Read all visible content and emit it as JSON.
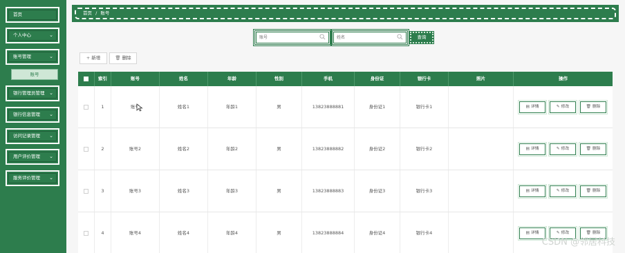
{
  "sidebar": {
    "items": [
      {
        "label": "首页",
        "has_chevron": false
      },
      {
        "label": "个人中心",
        "has_chevron": true
      },
      {
        "label": "账号管理",
        "has_chevron": true
      },
      {
        "label": "银行管理员管理",
        "has_chevron": true
      },
      {
        "label": "银行信息管理",
        "has_chevron": true
      },
      {
        "label": "访问记录管理",
        "has_chevron": true
      },
      {
        "label": "用户评价管理",
        "has_chevron": true
      },
      {
        "label": "服务评价管理",
        "has_chevron": true
      }
    ],
    "submenu": {
      "label": "账号"
    },
    "chevron_glyph": "⌄"
  },
  "breadcrumb": {
    "home": "首页",
    "separator": "/",
    "current": "账号"
  },
  "search": {
    "field1_placeholder": "账号",
    "field2_placeholder": "姓名",
    "button_label": "查询"
  },
  "toolbar": {
    "add_label": "新增",
    "delete_label": "删除"
  },
  "table": {
    "headers": [
      "",
      "索引",
      "账号",
      "姓名",
      "年龄",
      "性别",
      "手机",
      "身份证",
      "银行卡",
      "照片",
      "操作"
    ],
    "rows": [
      {
        "index": "1",
        "account": "账号",
        "name": "姓名1",
        "age": "年龄1",
        "gender": "男",
        "phone": "13823888881",
        "idcard": "身份证1",
        "bankcard": "银行卡1",
        "photo": ""
      },
      {
        "index": "2",
        "account": "账号2",
        "name": "姓名2",
        "age": "年龄2",
        "gender": "男",
        "phone": "13823888882",
        "idcard": "身份证2",
        "bankcard": "银行卡2",
        "photo": ""
      },
      {
        "index": "3",
        "account": "账号3",
        "name": "姓名3",
        "age": "年龄3",
        "gender": "男",
        "phone": "13823888883",
        "idcard": "身份证3",
        "bankcard": "银行卡3",
        "photo": ""
      },
      {
        "index": "4",
        "account": "账号4",
        "name": "姓名4",
        "age": "年龄4",
        "gender": "男",
        "phone": "13823888884",
        "idcard": "身份证4",
        "bankcard": "银行卡4",
        "photo": ""
      }
    ],
    "actions": {
      "detail": "详情",
      "edit": "修改",
      "delete": "删除"
    }
  },
  "watermark": "CSDN @邻居科技",
  "colors": {
    "primary": "#2d7d4d",
    "light": "#cfe7d6"
  }
}
